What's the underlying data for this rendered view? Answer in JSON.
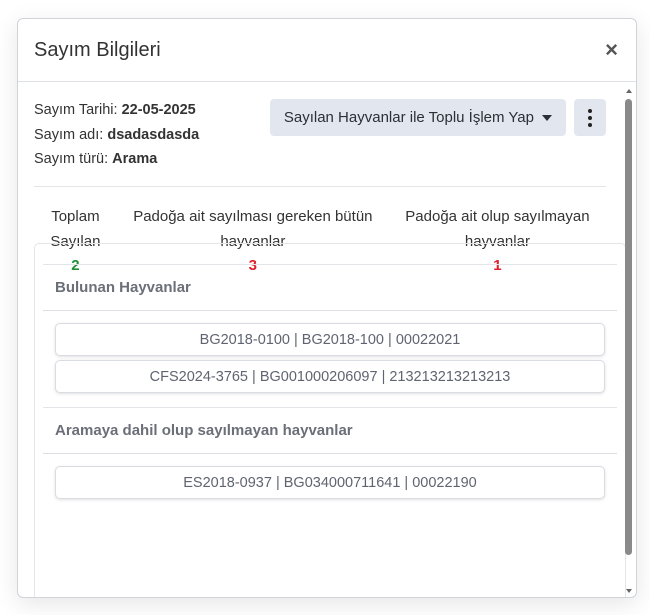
{
  "modal": {
    "title": "Sayım Bilgileri",
    "close_symbol": "×"
  },
  "info": {
    "date_label": "Sayım Tarihi:",
    "date_value": "22-05-2025",
    "name_label": "Sayım adı:",
    "name_value": "dsadasdasda",
    "type_label": "Sayım türü:",
    "type_value": "Arama"
  },
  "actions": {
    "bulk_label": "Sayılan Hayvanlar ile Toplu İşlem Yap",
    "more_icon": "vertical-ellipsis-icon"
  },
  "stats": [
    {
      "label_line1": "Toplam",
      "label_line2": "Sayılan",
      "value": "2",
      "color": "#1f8f3a"
    },
    {
      "label_line1": "Padoğa ait sayılması gereken bütün",
      "label_line2": "hayvanlar",
      "value": "3",
      "color": "#e0212e"
    },
    {
      "label_line1": "Padoğa ait olup sayılmayan",
      "label_line2": "hayvanlar",
      "value": "1",
      "color": "#e0212e"
    }
  ],
  "found": {
    "title": "Bulunan Hayvanlar",
    "items": [
      "BG2018-0100 | BG2018-100 | 00022021",
      "CFS2024-3765 | BG001000206097 | 213213213213213"
    ]
  },
  "not_counted": {
    "title": "Aramaya dahil olup sayılmayan hayvanlar",
    "items": [
      "ES2018-0937 | BG034000711641 | 00022190"
    ]
  }
}
